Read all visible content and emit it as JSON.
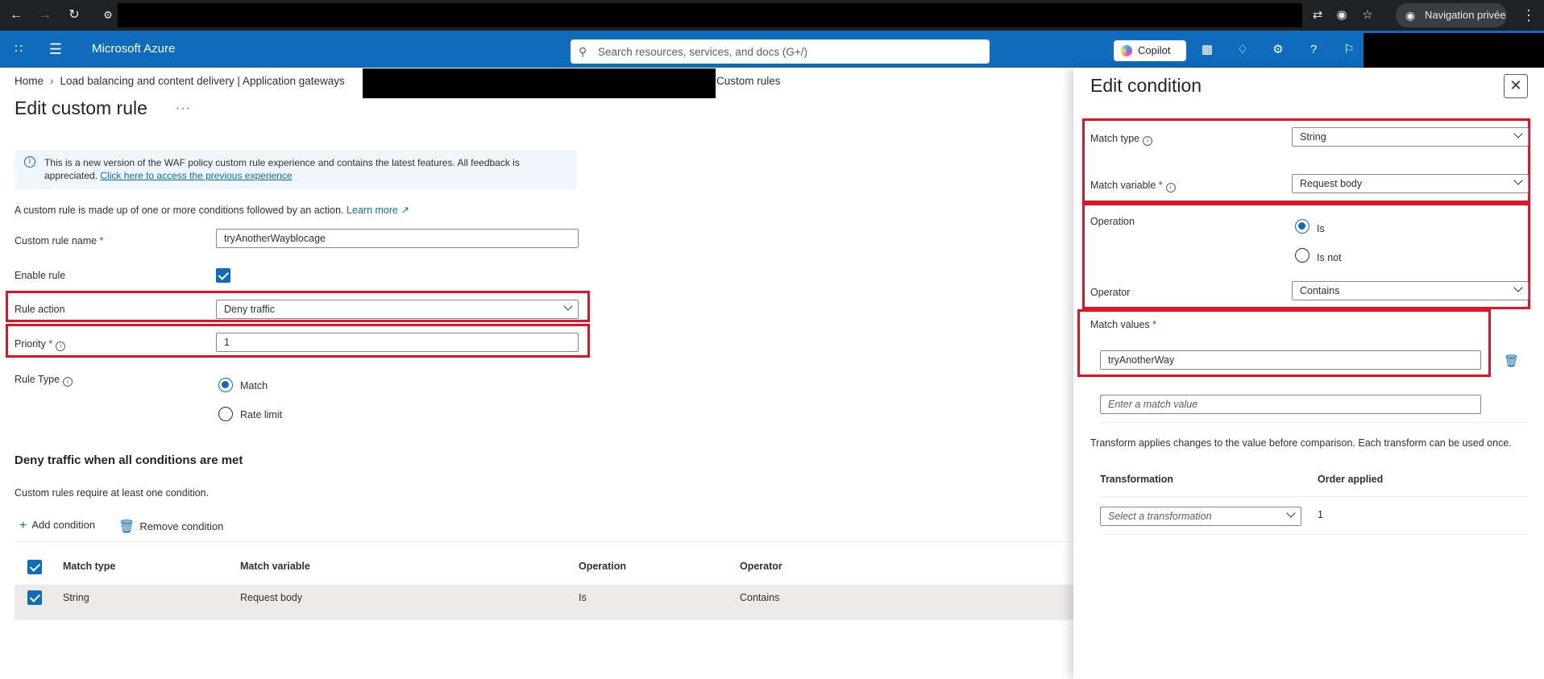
{
  "browser": {
    "private_label": "Navigation privée"
  },
  "header": {
    "brand": "Microsoft Azure",
    "search_placeholder": "Search resources, services, and docs (G+/)",
    "copilot_label": "Copilot"
  },
  "breadcrumb": {
    "items": [
      "Home",
      "Load balancing and content delivery | Application gateways"
    ],
    "tail": "Custom rules"
  },
  "page": {
    "title": "Edit custom rule",
    "more": "···"
  },
  "banner": {
    "text": "This is a new version of the WAF policy custom rule experience and contains the latest features. All feedback is appreciated.",
    "link": "Click here to access the previous experience"
  },
  "intro": {
    "text": "A custom rule is made up of one or more conditions followed by an action.",
    "link": "Learn more"
  },
  "form": {
    "name_label": "Custom rule name",
    "name_value": "tryAnotherWayblocage",
    "enable_label": "Enable rule",
    "action_label": "Rule action",
    "action_value": "Deny traffic",
    "priority_label": "Priority",
    "priority_value": "1",
    "rule_type_label": "Rule Type",
    "rule_type_options": [
      "Match",
      "Rate limit"
    ]
  },
  "conditions": {
    "heading": "Deny traffic when all conditions are met",
    "subtext": "Custom rules require at least one condition.",
    "add_label": "Add condition",
    "remove_label": "Remove condition",
    "columns": [
      "Match type",
      "Match variable",
      "Operation",
      "Operator"
    ],
    "rows": [
      {
        "match_type": "String",
        "match_variable": "Request body",
        "operation": "Is",
        "operator": "Contains"
      }
    ]
  },
  "panel": {
    "title": "Edit condition",
    "match_type_label": "Match type",
    "match_type_value": "String",
    "match_variable_label": "Match variable",
    "match_variable_value": "Request body",
    "operation_label": "Operation",
    "operation_options": [
      "Is",
      "Is not"
    ],
    "operator_label": "Operator",
    "operator_value": "Contains",
    "match_values_label": "Match values",
    "match_value_1": "tryAnotherWay",
    "match_value_placeholder": "Enter a match value",
    "transform_note": "Transform applies changes to the value before comparison. Each transform can be used once.",
    "transform_columns": [
      "Transformation",
      "Order applied"
    ],
    "transform_placeholder": "Select a transformation",
    "transform_order": "1"
  },
  "colors": {
    "azure_blue": "#0f6cbd",
    "highlight_red": "#e81123"
  }
}
